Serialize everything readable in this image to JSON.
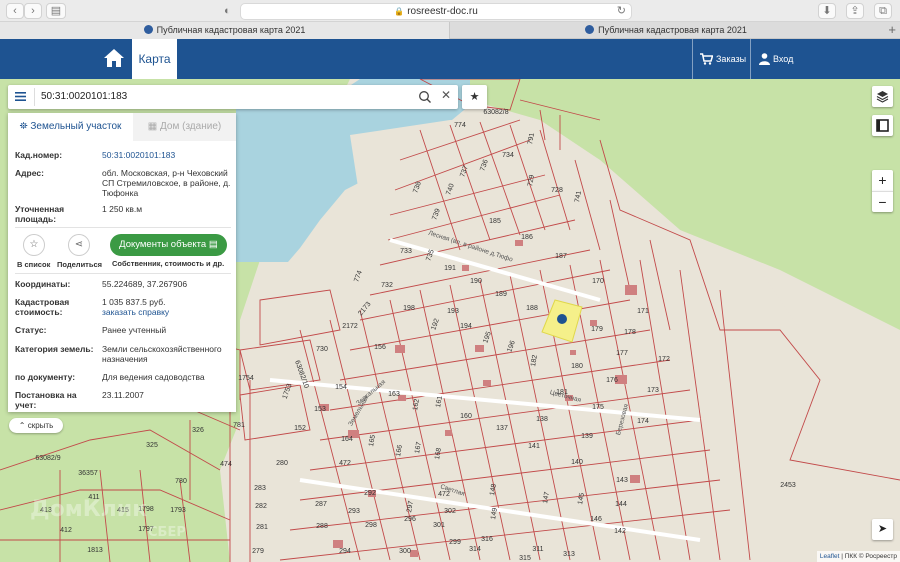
{
  "browser": {
    "url": "rosreestr-doc.ru",
    "tabs": [
      {
        "title": "Публичная кадастровая карта 2021"
      },
      {
        "title": "Публичная кадастровая карта 2021"
      }
    ],
    "new_tab": "+"
  },
  "header": {
    "map_tab": "Карта",
    "orders": "Заказы",
    "login": "Вход"
  },
  "search": {
    "value": "50:31:0020101:183"
  },
  "panel": {
    "tabs": {
      "land": "Земельный участок",
      "building": "Дом (здание)"
    },
    "fields": [
      {
        "label": "Кад.номер:",
        "value": "50:31:0020101:183",
        "link": true
      },
      {
        "label": "Адрес:",
        "value": "обл. Московская, р-н Чеховский СП Стремиловское, в районе, д. Тюфонка"
      },
      {
        "label": "Уточненная площадь:",
        "value": "1 250 кв.м"
      }
    ],
    "actions": {
      "list": "В список",
      "share": "Поделиться",
      "docs_button": "Документы объекта",
      "docs_sub": "Собственник, стоимость и др."
    },
    "fields2": [
      {
        "label": "Координаты:",
        "value": "55.224689, 37.267906"
      },
      {
        "label": "Кадастровая стоимость:",
        "value": "1 035 837.5 руб.",
        "link_text": "заказать справку"
      },
      {
        "label": "Статус:",
        "value": "Ранее учтенный"
      },
      {
        "label": "Категория земель:",
        "value": "Земли сельскохозяйственного назначения"
      },
      {
        "label": "по документу:",
        "value": "Для ведения садоводства"
      },
      {
        "label": "Постановка на учет:",
        "value": "23.11.2007"
      }
    ],
    "hide": "скрыть"
  },
  "map": {
    "zoom_in": "+",
    "zoom_out": "−",
    "attribution_leaflet": "Leaflet",
    "attribution_rest": " | ПКК © Росреестр",
    "watermark_domclick": "ДомКлик",
    "watermark_sber": "СБЕР",
    "parcel_labels": [
      {
        "t": "774"
      },
      {
        "t": "63082/8"
      },
      {
        "t": "791"
      },
      {
        "t": "734"
      },
      {
        "t": "736"
      },
      {
        "t": "737"
      },
      {
        "t": "729"
      },
      {
        "t": "738"
      },
      {
        "t": "740"
      },
      {
        "t": "728"
      },
      {
        "t": "741"
      },
      {
        "t": "739"
      },
      {
        "t": "185"
      },
      {
        "t": "186"
      },
      {
        "t": "187"
      },
      {
        "t": "733"
      },
      {
        "t": "735"
      },
      {
        "t": "191"
      },
      {
        "t": "170"
      },
      {
        "t": "774"
      },
      {
        "t": "732"
      },
      {
        "t": "190"
      },
      {
        "t": "189"
      },
      {
        "t": "188"
      },
      {
        "t": "171"
      },
      {
        "t": "2173"
      },
      {
        "t": "198"
      },
      {
        "t": "192"
      },
      {
        "t": "193"
      },
      {
        "t": "179"
      },
      {
        "t": "178"
      },
      {
        "t": "2172"
      },
      {
        "t": "194"
      },
      {
        "t": "195"
      },
      {
        "t": "196"
      },
      {
        "t": "182"
      },
      {
        "t": "177"
      },
      {
        "t": "172"
      },
      {
        "t": "730"
      },
      {
        "t": "156"
      },
      {
        "t": "180"
      },
      {
        "t": "176"
      },
      {
        "t": "173"
      },
      {
        "t": "1754"
      },
      {
        "t": "154"
      },
      {
        "t": "163"
      },
      {
        "t": "162"
      },
      {
        "t": "161"
      },
      {
        "t": "160"
      },
      {
        "t": "181"
      },
      {
        "t": "175"
      },
      {
        "t": "174"
      },
      {
        "t": "1753"
      },
      {
        "t": "153"
      },
      {
        "t": "138"
      },
      {
        "t": "139"
      },
      {
        "t": "326"
      },
      {
        "t": "781"
      },
      {
        "t": "152"
      },
      {
        "t": "164"
      },
      {
        "t": "165"
      },
      {
        "t": "166"
      },
      {
        "t": "167"
      },
      {
        "t": "168"
      },
      {
        "t": "137"
      },
      {
        "t": "141"
      },
      {
        "t": "140"
      },
      {
        "t": "325"
      },
      {
        "t": "474"
      },
      {
        "t": "280"
      },
      {
        "t": "472"
      },
      {
        "t": "148"
      },
      {
        "t": "143"
      },
      {
        "t": "63082/9"
      },
      {
        "t": "36357"
      },
      {
        "t": "780"
      },
      {
        "t": "411"
      },
      {
        "t": "2453"
      },
      {
        "t": "283"
      },
      {
        "t": "292"
      },
      {
        "t": "297"
      },
      {
        "t": "149"
      },
      {
        "t": "147"
      },
      {
        "t": "145"
      },
      {
        "t": "144"
      },
      {
        "t": "413"
      },
      {
        "t": "415"
      },
      {
        "t": "1798"
      },
      {
        "t": "282"
      },
      {
        "t": "287"
      },
      {
        "t": "293"
      },
      {
        "t": "302"
      },
      {
        "t": "296"
      },
      {
        "t": "146"
      },
      {
        "t": "412"
      },
      {
        "t": "1797"
      },
      {
        "t": "281"
      },
      {
        "t": "288"
      },
      {
        "t": "298"
      },
      {
        "t": "301"
      },
      {
        "t": "299"
      },
      {
        "t": "316"
      },
      {
        "t": "311"
      },
      {
        "t": "142"
      },
      {
        "t": "1813"
      },
      {
        "t": "279"
      },
      {
        "t": "294"
      },
      {
        "t": "300"
      },
      {
        "t": "314"
      },
      {
        "t": "315"
      },
      {
        "t": "313"
      },
      {
        "t": "472"
      },
      {
        "t": "1793"
      },
      {
        "t": "63082/10"
      }
    ],
    "street_labels": [
      {
        "t": "Лесная (вл. в районе д.Тюфо"
      },
      {
        "t": "Земельная"
      },
      {
        "t": "Зеркальная"
      },
      {
        "t": "Цветочная"
      },
      {
        "t": "Березовая"
      },
      {
        "t": "Светлая"
      }
    ]
  },
  "colors": {
    "header_bg": "#1e5391",
    "water": "#a9d3df",
    "forest": "#c7e2a7",
    "land": "#e9e4d8",
    "parcel_line": "#c24a4a",
    "selected_parcel": "#f5f08a",
    "docs_button": "#3b9a44"
  }
}
